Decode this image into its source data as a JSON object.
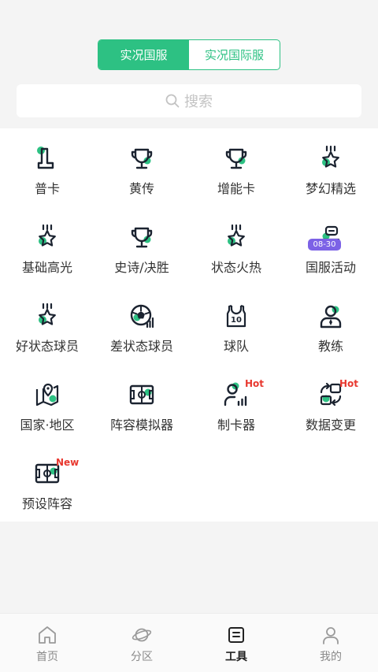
{
  "segment": {
    "options": [
      "实况国服",
      "实况国际服"
    ],
    "selected": 0
  },
  "search": {
    "placeholder": "搜索"
  },
  "tools": [
    {
      "label": "普卡",
      "icon": "card-icon"
    },
    {
      "label": "黄传",
      "icon": "trophy-icon"
    },
    {
      "label": "增能卡",
      "icon": "trophy-icon"
    },
    {
      "label": "梦幻精选",
      "icon": "star-medal-icon"
    },
    {
      "label": "基础高光",
      "icon": "star-medal-icon"
    },
    {
      "label": "史诗/决胜",
      "icon": "trophy-icon"
    },
    {
      "label": "状态火热",
      "icon": "star-medal-icon"
    },
    {
      "label": "国服活动",
      "icon": "event-icon",
      "badge": "08-30"
    },
    {
      "label": "好状态球员",
      "icon": "star-medal-icon"
    },
    {
      "label": "差状态球员",
      "icon": "football-stats-icon"
    },
    {
      "label": "球队",
      "icon": "jersey-icon",
      "jersey_number": "10"
    },
    {
      "label": "教练",
      "icon": "coach-icon"
    },
    {
      "label": "国家·地区",
      "icon": "map-pin-icon"
    },
    {
      "label": "阵容模拟器",
      "icon": "pitch-icon"
    },
    {
      "label": "制卡器",
      "icon": "card-maker-icon",
      "badge": "Hot"
    },
    {
      "label": "数据变更",
      "icon": "data-change-icon",
      "badge": "Hot"
    },
    {
      "label": "预设阵容",
      "icon": "pitch-icon",
      "badge": "New"
    }
  ],
  "tabbar": {
    "items": [
      "首页",
      "分区",
      "工具",
      "我的"
    ],
    "active": 2
  },
  "colors": {
    "accent": "#2dc183",
    "hot": "#e8382f",
    "event_badge": "#7c62e6",
    "icon_dark": "#1b2330"
  }
}
